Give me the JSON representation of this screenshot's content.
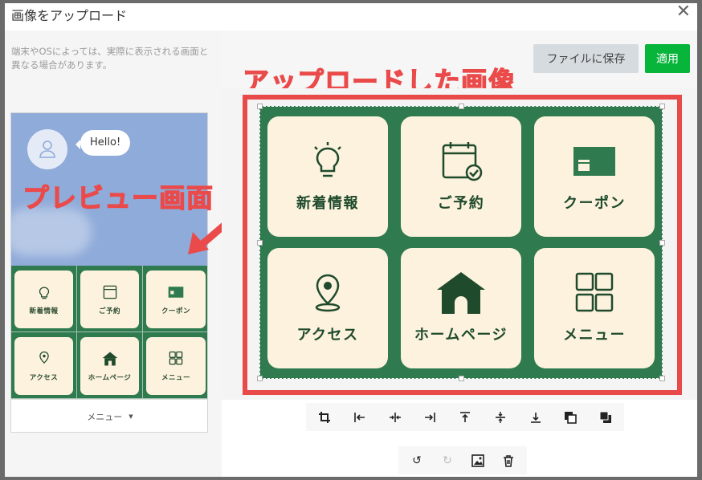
{
  "dialog": {
    "title": "画像をアップロード",
    "close_glyph": "✕"
  },
  "left": {
    "note": "端末やOSによっては、実際に表示される画面と異なる場合があります。",
    "bubble": "Hello!",
    "menu_bar_label": "メニュー",
    "menu_bar_caret": "▼",
    "overlay": "プレビュー画面"
  },
  "right": {
    "save_to_file": "ファイルに保存",
    "apply": "適用",
    "overlay": "アップロードした画像"
  },
  "tiles": [
    {
      "label": "新着情報",
      "icon": "lightbulb-icon"
    },
    {
      "label": "ご予約",
      "icon": "calendar-check-icon"
    },
    {
      "label": "クーポン",
      "icon": "gift-card-icon"
    },
    {
      "label": "アクセス",
      "icon": "map-pin-icon"
    },
    {
      "label": "ホームページ",
      "icon": "house-icon"
    },
    {
      "label": "メニュー",
      "icon": "grid-icon"
    }
  ],
  "tools_row1": [
    {
      "name": "crop-icon",
      "glyph": "⌗"
    },
    {
      "name": "align-left-icon",
      "glyph": "|←"
    },
    {
      "name": "align-center-h-icon",
      "glyph": "→|←"
    },
    {
      "name": "align-right-icon",
      "glyph": "→|"
    },
    {
      "name": "align-top-icon",
      "glyph": "⊤"
    },
    {
      "name": "align-middle-v-icon",
      "glyph": "‡"
    },
    {
      "name": "align-bottom-icon",
      "glyph": "⊥"
    },
    {
      "name": "send-backward-icon",
      "glyph": "⧉"
    },
    {
      "name": "bring-forward-icon",
      "glyph": "◼"
    }
  ],
  "tools_row2": [
    {
      "name": "undo-icon",
      "glyph": "↺"
    },
    {
      "name": "redo-icon",
      "glyph": "↻"
    },
    {
      "name": "image-icon",
      "glyph": "▣"
    },
    {
      "name": "trash-icon",
      "glyph": "🗑"
    }
  ],
  "colors": {
    "accent_green": "#07b53b",
    "menu_green": "#2f7a4e",
    "tile_cream": "#fcf2dd",
    "annotation_red": "#e84a4a"
  }
}
